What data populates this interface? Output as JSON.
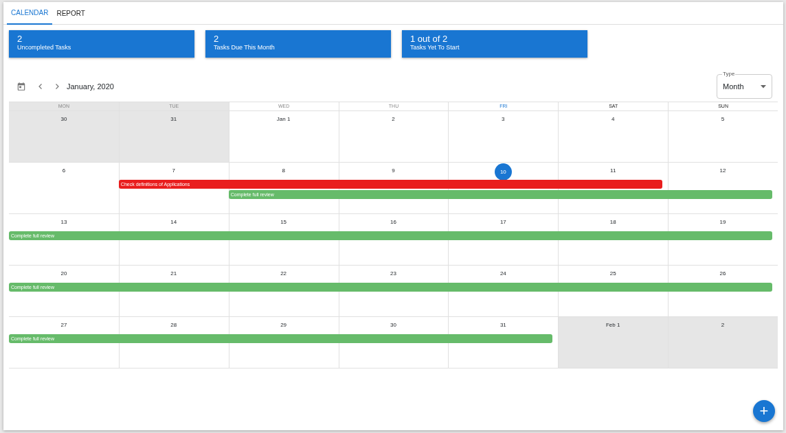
{
  "tabs": [
    {
      "label": "CALENDAR",
      "selected": true
    },
    {
      "label": "REPORT",
      "selected": false
    }
  ],
  "stats": [
    {
      "value": "2",
      "label": "Uncompleted Tasks"
    },
    {
      "value": "2",
      "label": "Tasks Due This Month"
    },
    {
      "value": "1 out of 2",
      "label": "Tasks Yet To Start"
    }
  ],
  "toolbar": {
    "title": "January, 2020",
    "type_select": {
      "label": "Type",
      "value": "Month"
    }
  },
  "calendar": {
    "weekdays": [
      {
        "label": "MON",
        "past": true,
        "today": false
      },
      {
        "label": "TUE",
        "past": true,
        "today": false
      },
      {
        "label": "WED",
        "past": true,
        "today": false
      },
      {
        "label": "THU",
        "past": true,
        "today": false
      },
      {
        "label": "FRI",
        "past": false,
        "today": true
      },
      {
        "label": "SAT",
        "past": false,
        "today": false
      },
      {
        "label": "SUN",
        "past": false,
        "today": false
      }
    ],
    "weeks": [
      {
        "days": [
          {
            "label": "30",
            "outside": true,
            "today": false
          },
          {
            "label": "31",
            "outside": true,
            "today": false
          },
          {
            "label": "Jan 1",
            "outside": false,
            "today": false
          },
          {
            "label": "2",
            "outside": false,
            "today": false
          },
          {
            "label": "3",
            "outside": false,
            "today": false
          },
          {
            "label": "4",
            "outside": false,
            "today": false
          },
          {
            "label": "5",
            "outside": false,
            "today": false
          }
        ]
      },
      {
        "days": [
          {
            "label": "6",
            "outside": false,
            "today": false
          },
          {
            "label": "7",
            "outside": false,
            "today": false
          },
          {
            "label": "8",
            "outside": false,
            "today": false
          },
          {
            "label": "9",
            "outside": false,
            "today": false
          },
          {
            "label": "10",
            "outside": false,
            "today": true
          },
          {
            "label": "11",
            "outside": false,
            "today": false
          },
          {
            "label": "12",
            "outside": false,
            "today": false
          }
        ],
        "events": [
          {
            "title": "Check definitions of Applications",
            "color": "#e91e1e",
            "covers": [
              false,
              true,
              true,
              true,
              true,
              true,
              false
            ]
          },
          {
            "title": "Complete full review",
            "color": "#66bb6a",
            "covers": [
              false,
              false,
              true,
              true,
              true,
              true,
              true
            ]
          }
        ]
      },
      {
        "days": [
          {
            "label": "13",
            "outside": false,
            "today": false
          },
          {
            "label": "14",
            "outside": false,
            "today": false
          },
          {
            "label": "15",
            "outside": false,
            "today": false
          },
          {
            "label": "16",
            "outside": false,
            "today": false
          },
          {
            "label": "17",
            "outside": false,
            "today": false
          },
          {
            "label": "18",
            "outside": false,
            "today": false
          },
          {
            "label": "19",
            "outside": false,
            "today": false
          }
        ],
        "events": [
          {
            "title": "Complete full review",
            "color": "#66bb6a",
            "covers": [
              true,
              true,
              true,
              true,
              true,
              true,
              true
            ]
          }
        ]
      },
      {
        "days": [
          {
            "label": "20",
            "outside": false,
            "today": false
          },
          {
            "label": "21",
            "outside": false,
            "today": false
          },
          {
            "label": "22",
            "outside": false,
            "today": false
          },
          {
            "label": "23",
            "outside": false,
            "today": false
          },
          {
            "label": "24",
            "outside": false,
            "today": false
          },
          {
            "label": "25",
            "outside": false,
            "today": false
          },
          {
            "label": "26",
            "outside": false,
            "today": false
          }
        ],
        "events": [
          {
            "title": "Complete full review",
            "color": "#66bb6a",
            "covers": [
              true,
              true,
              true,
              true,
              true,
              true,
              true
            ]
          }
        ]
      },
      {
        "days": [
          {
            "label": "27",
            "outside": false,
            "today": false
          },
          {
            "label": "28",
            "outside": false,
            "today": false
          },
          {
            "label": "29",
            "outside": false,
            "today": false
          },
          {
            "label": "30",
            "outside": false,
            "today": false
          },
          {
            "label": "31",
            "outside": false,
            "today": false
          },
          {
            "label": "Feb 1",
            "outside": true,
            "today": false
          },
          {
            "label": "2",
            "outside": true,
            "today": false
          }
        ],
        "events": [
          {
            "title": "Complete full review",
            "color": "#66bb6a",
            "covers": [
              true,
              true,
              true,
              true,
              true,
              false,
              false
            ]
          }
        ]
      }
    ]
  },
  "fab": {
    "label": "+"
  }
}
